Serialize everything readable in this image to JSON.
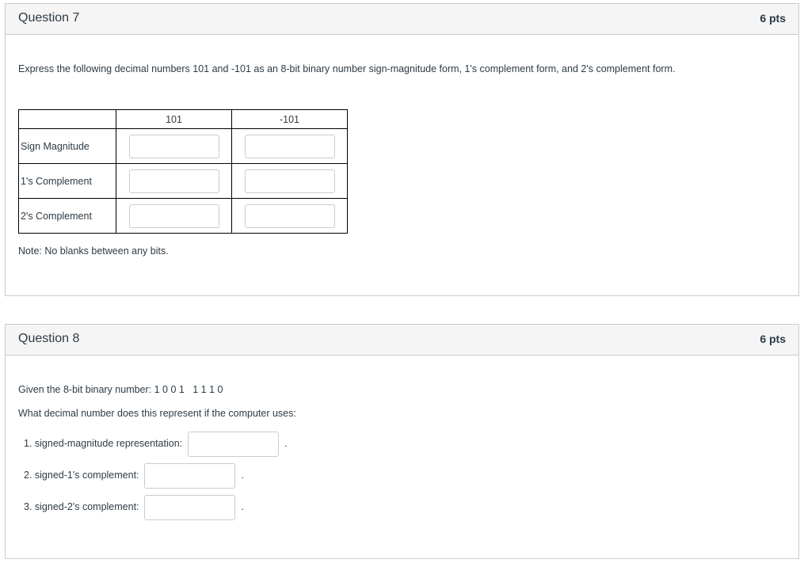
{
  "question7": {
    "title": "Question 7",
    "points": "6 pts",
    "prompt": "Express the following decimal numbers 101 and -101 as an 8-bit binary number sign-magnitude form, 1's complement form, and 2's complement form.",
    "table": {
      "columns": [
        "",
        "101",
        "-101"
      ],
      "rows": [
        {
          "label": "Sign Magnitude",
          "values": [
            "",
            ""
          ]
        },
        {
          "label": "1's Complement",
          "values": [
            "",
            ""
          ]
        },
        {
          "label": "2's Complement",
          "values": [
            "",
            ""
          ]
        }
      ]
    },
    "note": "Note: No blanks between any bits."
  },
  "question8": {
    "title": "Question 8",
    "points": "6 pts",
    "given": "Given the 8-bit binary number: 1 0 0 1   1 1 1 0",
    "ask": "What decimal number does this represent if the computer uses:",
    "items": [
      {
        "label": "1. signed-magnitude representation:",
        "value": "",
        "suffix": "."
      },
      {
        "label": "2. signed-1's complement:",
        "value": "",
        "suffix": "."
      },
      {
        "label": "3. signed-2's complement:",
        "value": "",
        "suffix": "."
      }
    ]
  }
}
